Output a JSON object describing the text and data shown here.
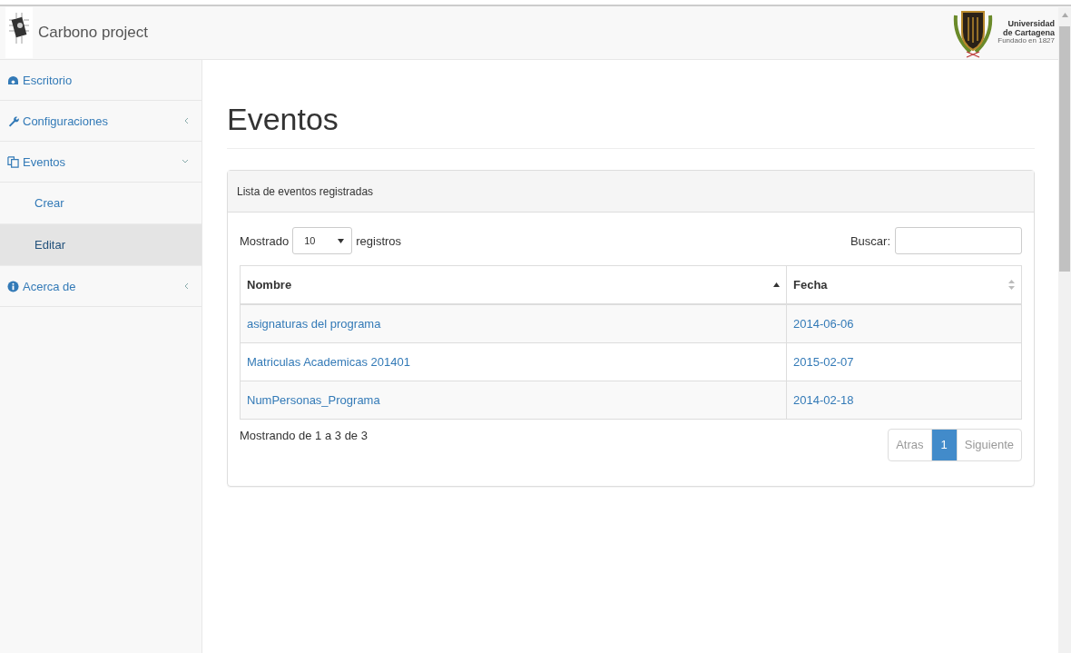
{
  "header": {
    "brand": "Carbono project",
    "university": {
      "name_line1": "Universidad",
      "name_line2": "de Cartagena",
      "founded": "Fundado en 1827"
    }
  },
  "sidebar": {
    "items": [
      {
        "label": "Escritorio"
      },
      {
        "label": "Configuraciones",
        "expanded": false
      },
      {
        "label": "Eventos",
        "expanded": true,
        "children": [
          {
            "label": "Crear",
            "selected": false
          },
          {
            "label": "Editar",
            "selected": true
          }
        ]
      },
      {
        "label": "Acerca de",
        "expanded": false
      }
    ]
  },
  "page": {
    "title": "Eventos"
  },
  "panel": {
    "heading": "Lista de eventos registradas",
    "length": {
      "before": "Mostrado",
      "value": "10",
      "after": "registros"
    },
    "search": {
      "label": "Buscar:"
    },
    "table": {
      "columns": [
        {
          "label": "Nombre",
          "sorted": true
        },
        {
          "label": "Fecha",
          "sorted": false
        }
      ],
      "rows": [
        [
          "asignaturas del programa",
          "2014-06-06"
        ],
        [
          "Matriculas Academicas 201401",
          "2015-02-07"
        ],
        [
          "NumPersonas_Programa",
          "2014-02-18"
        ]
      ]
    },
    "info": "Mostrando de 1 a 3 de 3",
    "pagination": [
      {
        "label": "Atras",
        "selected": false,
        "disabled": true
      },
      {
        "label": "1",
        "selected": true,
        "disabled": false
      },
      {
        "label": "Siguiente",
        "selected": false,
        "disabled": true
      }
    ]
  }
}
